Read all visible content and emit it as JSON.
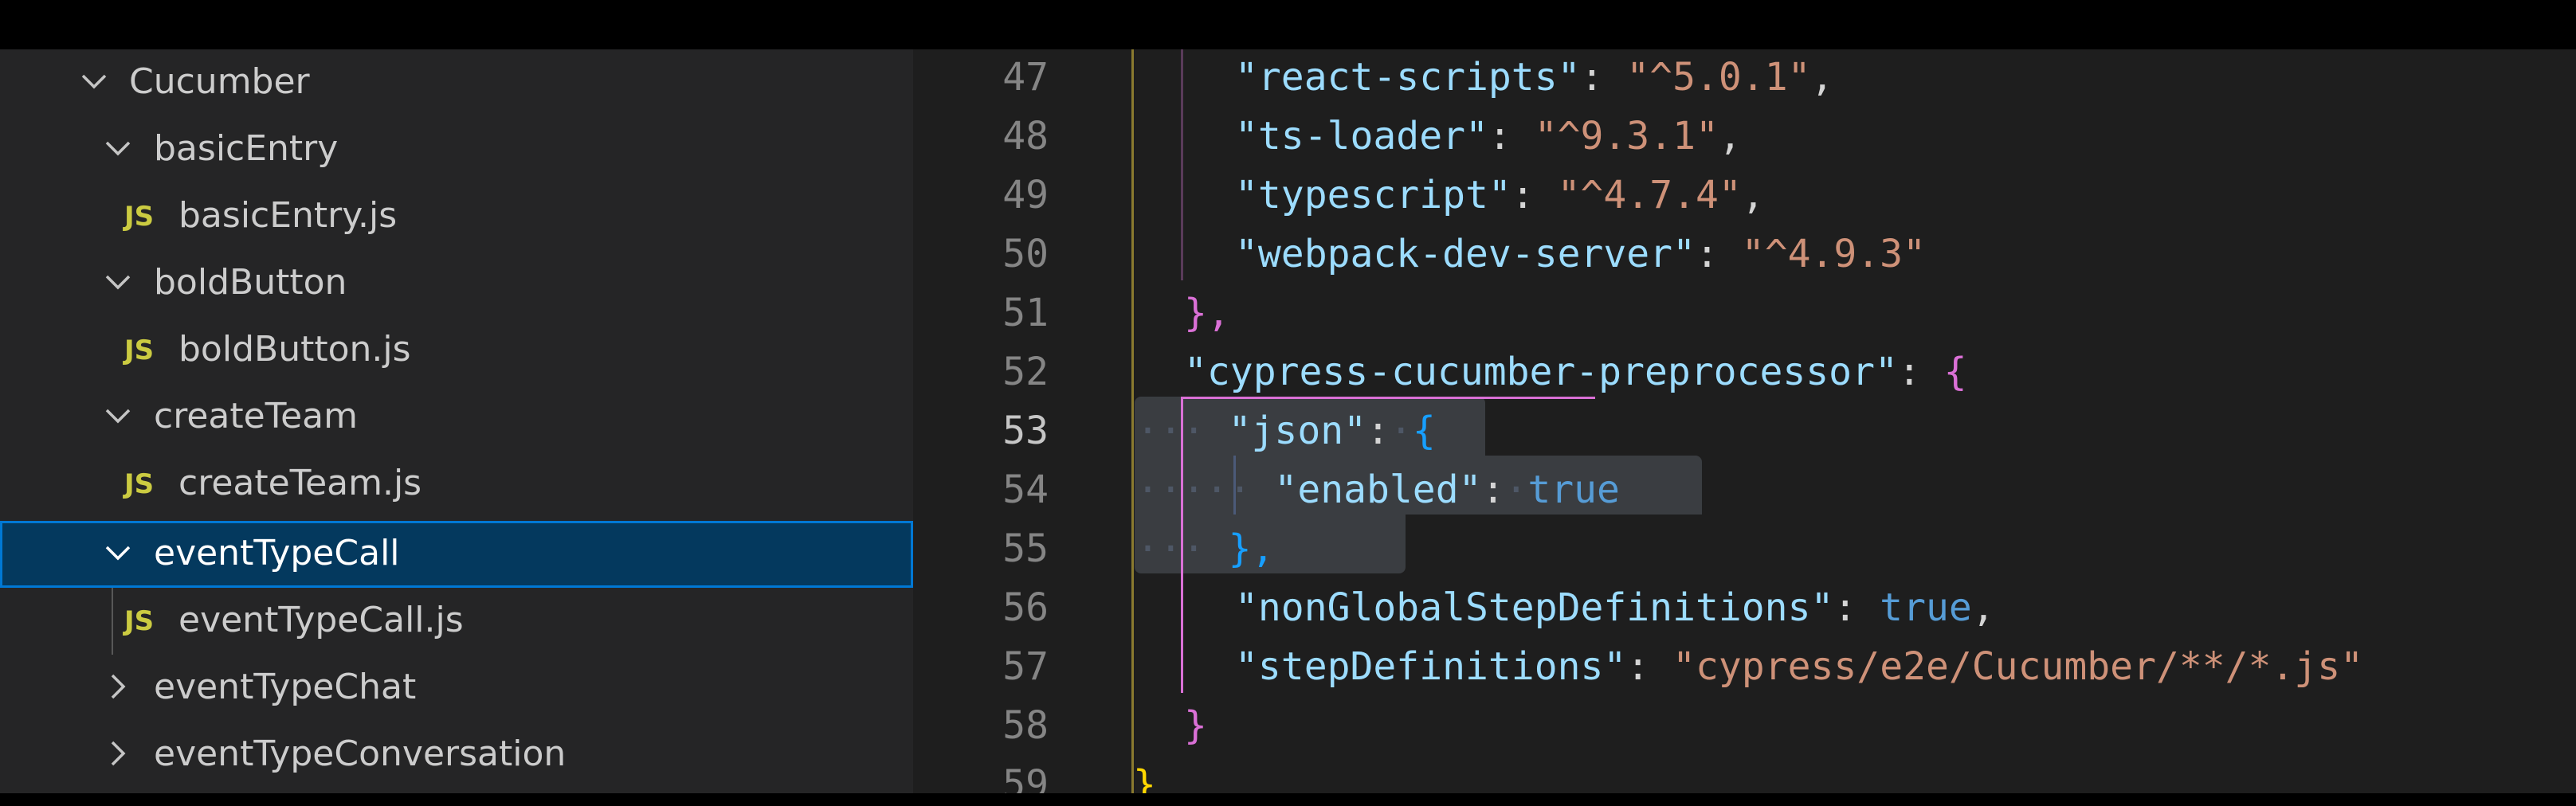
{
  "explorer": {
    "items": [
      {
        "label": "Cucumber",
        "kind": "folder",
        "expanded": true
      },
      {
        "label": "basicEntry",
        "kind": "folder",
        "expanded": true
      },
      {
        "label": "basicEntry.js",
        "kind": "file",
        "icon": "JS"
      },
      {
        "label": "boldButton",
        "kind": "folder",
        "expanded": true
      },
      {
        "label": "boldButton.js",
        "kind": "file",
        "icon": "JS"
      },
      {
        "label": "createTeam",
        "kind": "folder",
        "expanded": true
      },
      {
        "label": "createTeam.js",
        "kind": "file",
        "icon": "JS"
      },
      {
        "label": "eventTypeCall",
        "kind": "folder",
        "expanded": true,
        "selected": true
      },
      {
        "label": "eventTypeCall.js",
        "kind": "file",
        "icon": "JS"
      },
      {
        "label": "eventTypeChat",
        "kind": "folder",
        "expanded": false
      },
      {
        "label": "eventTypeConversation",
        "kind": "folder",
        "expanded": false
      }
    ]
  },
  "editor": {
    "current_line": 53,
    "lines": [
      {
        "n": 47,
        "key": "react-scripts",
        "value": "^5.0.1"
      },
      {
        "n": 48,
        "key": "ts-loader",
        "value": "^9.3.1"
      },
      {
        "n": 49,
        "key": "typescript",
        "value": "^4.7.4"
      },
      {
        "n": 50,
        "key": "webpack-dev-server",
        "value": "^4.9.3"
      },
      {
        "n": 51,
        "text": "},"
      },
      {
        "n": 52,
        "key": "cypress-cucumber-preprocessor",
        "text": "{"
      },
      {
        "n": 53,
        "key": "json",
        "text": "{"
      },
      {
        "n": 54,
        "key": "enabled",
        "value_keyword": "true"
      },
      {
        "n": 55,
        "text": "},"
      },
      {
        "n": 56,
        "key": "nonGlobalStepDefinitions",
        "value_keyword": "true"
      },
      {
        "n": 57,
        "key": "stepDefinitions",
        "value": "cypress/e2e/Cucumber/**/*.js"
      },
      {
        "n": 58,
        "text": "}"
      },
      {
        "n": 59,
        "text": "}"
      }
    ]
  },
  "colors": {
    "sidebar_bg": "#252526",
    "editor_bg": "#1e1e1e",
    "selection_bg": "#04395e",
    "selection_border": "#0078d4",
    "js_icon": "#cbcb41",
    "json_key": "#9cdcfe",
    "json_string": "#ce9178",
    "json_keyword": "#569cd6",
    "bracket_yellow": "#ffd700",
    "bracket_pink": "#da70d6",
    "bracket_blue": "#179fff"
  },
  "icons": {
    "expanded": "chevron-down-icon",
    "collapsed": "chevron-right-icon",
    "js_file": "js-file-icon"
  }
}
